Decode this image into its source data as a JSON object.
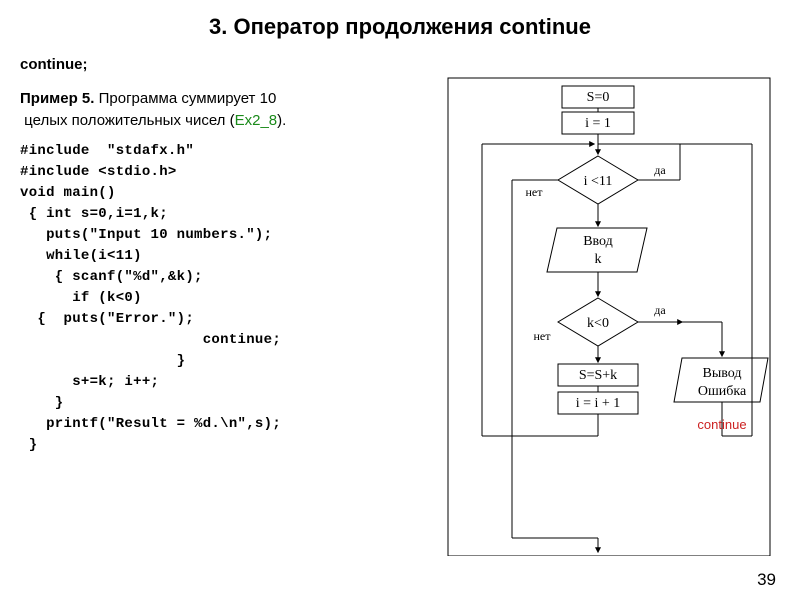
{
  "title": "3. Оператор продолжения continue",
  "stmt": "continue;",
  "example": {
    "label": "Пример 5.",
    "text1": " Программа суммирует 10",
    "text2": "целых положительных чисел (",
    "ref": "Ex2_8",
    "text3": ")."
  },
  "code": {
    "l1": "#include  \"stdafx.h\"",
    "l2": "#include <stdio.h>",
    "l3": "void main()",
    "l4": " { int s=0,i=1,k;",
    "l5": "   puts(\"Input 10 numbers.\");",
    "l6": "   while(i<11)",
    "l7": "    { scanf(\"%d\",&k);",
    "l8": "      if (k<0)",
    "l9": "  {  puts(\"Error.\");",
    "l10": "                     continue;",
    "l11": "                  }",
    "l12": "      s+=k; i++;",
    "l13": "    }",
    "l14": "   printf(\"Result = %d.\\n\",s);",
    "l15": " }"
  },
  "flow": {
    "init1": "S=0",
    "init2": "i = 1",
    "cond1": "i <11",
    "cond1_yes": "да",
    "cond1_no": "нет",
    "input": "Ввод",
    "input2": "k",
    "cond2": "k<0",
    "cond2_yes": "да",
    "cond2_no": "нет",
    "sum": "S=S+k",
    "inc": "i = i + 1",
    "err1": "Вывод",
    "err2": "Ошибка",
    "continue_label": "continue"
  },
  "page": "39"
}
